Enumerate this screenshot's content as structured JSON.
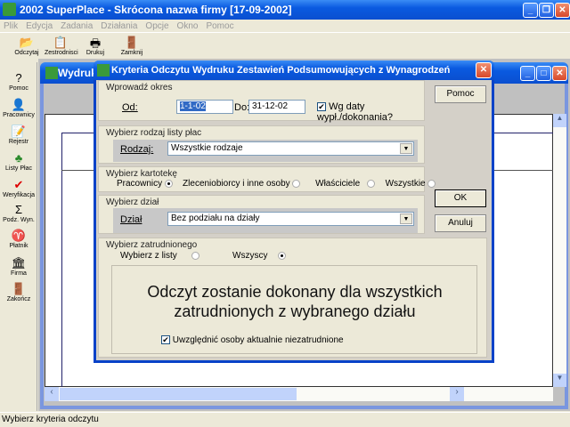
{
  "app": {
    "title": "2002 SuperPlace - Skrócona nazwa firmy [17-09-2002]"
  },
  "menu": [
    "Plik",
    "Edycja",
    "Zadania",
    "Działania",
    "Opcje",
    "Okno",
    "Pomoc"
  ],
  "toolbar": [
    {
      "label": "Odczytaj",
      "icon": "folder-open-icon"
    },
    {
      "label": "Zestrodnisci",
      "icon": "copy-icon"
    },
    {
      "label": "Drukuj",
      "icon": "printer-icon"
    },
    {
      "label": "Zamknij",
      "icon": "exit-door-icon"
    }
  ],
  "sidebar": [
    {
      "label": "Pomoc",
      "icon": "help-icon"
    },
    {
      "label": "Pracownicy",
      "icon": "employee-icon"
    },
    {
      "label": "Rejestr",
      "icon": "register-icon"
    },
    {
      "label": "Listy Płac",
      "icon": "payroll-icon"
    },
    {
      "label": "Weryfikacja",
      "icon": "check-icon"
    },
    {
      "label": "Podz. Wyn.",
      "icon": "sigma-icon"
    },
    {
      "label": "Płatnik",
      "icon": "payer-icon"
    },
    {
      "label": "Firma",
      "icon": "company-icon"
    },
    {
      "label": "Zakończ",
      "icon": "exit-door-icon"
    }
  ],
  "child": {
    "title": "Wydruk"
  },
  "dialog": {
    "title": "Kryteria Odczytu Wydruku Zestawień Podsumowujących z Wynagrodzeń",
    "period": {
      "caption": "Wprowadź okres",
      "from_label": "Od:",
      "from": "1-1-02",
      "to_label": "Do:",
      "to": "31-12-02",
      "by_date_label": "Wg daty wypł./dokonania?",
      "by_date_checked": true
    },
    "payroll": {
      "caption": "Wybierz rodzaj listy płac",
      "label": "Rodzaj:",
      "value": "Wszystkie rodzaje"
    },
    "card": {
      "caption": "Wybierz kartotekę",
      "options": [
        {
          "label": "Pracownicy",
          "selected": true
        },
        {
          "label": "Zleceniobiorcy i inne osoby",
          "selected": false
        },
        {
          "label": "Właściciele",
          "selected": false
        },
        {
          "label": "Wszystkie",
          "selected": false
        }
      ]
    },
    "dept": {
      "caption": "Wybierz dział",
      "label": "Dział",
      "value": "Bez podziału na działy"
    },
    "employee": {
      "caption": "Wybierz zatrudnionego",
      "from_list": "Wybierz z listy",
      "all": "Wszyscy",
      "all_selected": true,
      "info": "Odczyt zostanie dokonany dla wszystkich zatrudnionych z wybranego działu",
      "include_label": "Uwzględnić osoby aktualnie niezatrudnione",
      "include_checked": true
    },
    "buttons": {
      "help": "Pomoc",
      "ok": "OK",
      "cancel": "Anuluj"
    }
  },
  "status": "Wybierz kryteria odczytu"
}
